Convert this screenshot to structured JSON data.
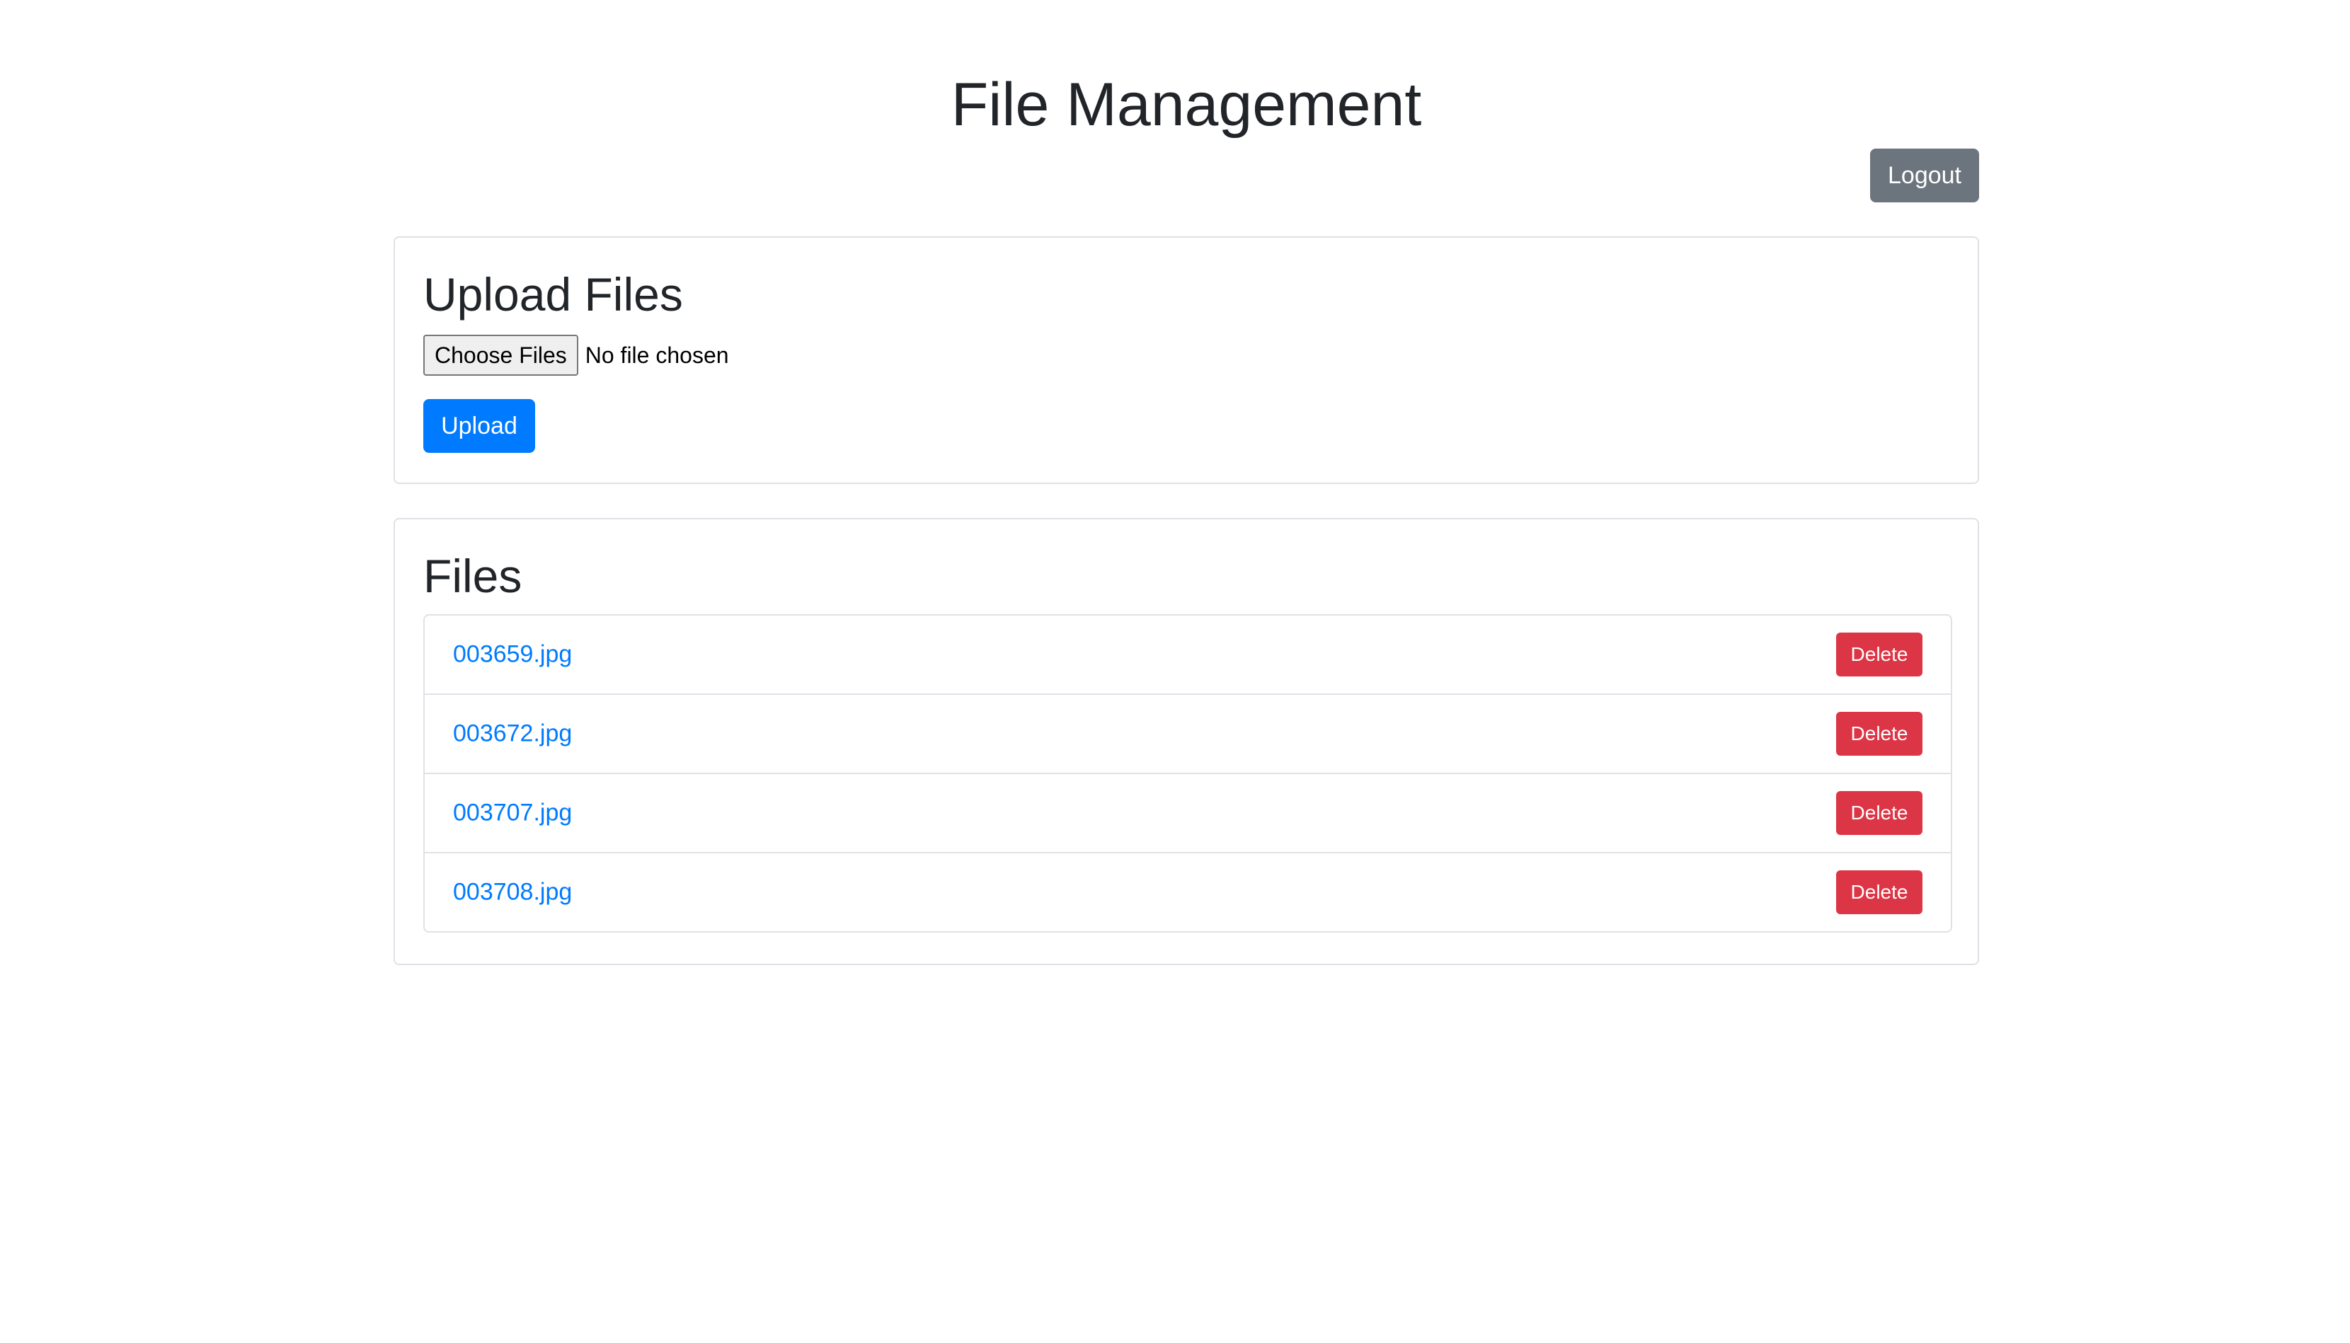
{
  "header": {
    "title": "File Management",
    "logout_label": "Logout"
  },
  "upload": {
    "heading": "Upload Files",
    "choose_label": "Choose Files",
    "no_file_text": "No file chosen",
    "upload_label": "Upload"
  },
  "files": {
    "heading": "Files",
    "delete_label": "Delete",
    "items": [
      {
        "name": "003659.jpg"
      },
      {
        "name": "003672.jpg"
      },
      {
        "name": "003707.jpg"
      },
      {
        "name": "003708.jpg"
      }
    ]
  },
  "colors": {
    "primary": "#007bff",
    "danger": "#dc3545",
    "secondary": "#6c757d",
    "border": "#dee2e6",
    "text": "#212529"
  }
}
